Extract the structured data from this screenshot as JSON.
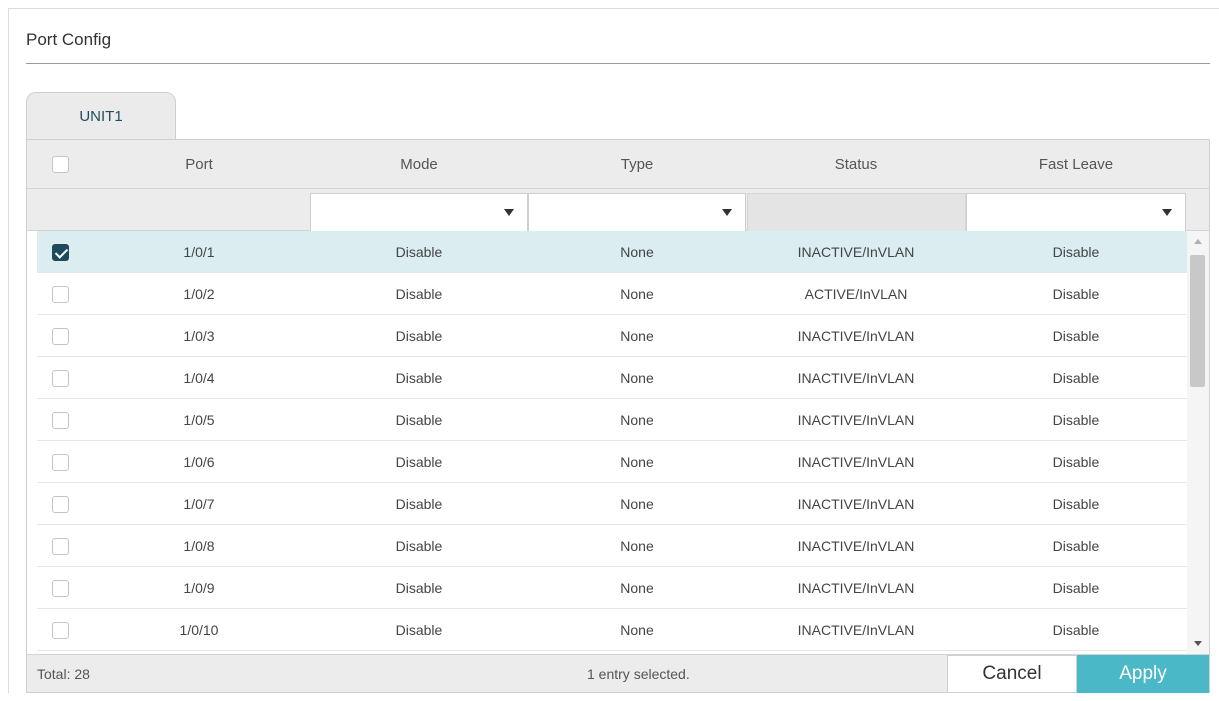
{
  "page": {
    "title": "Port Config"
  },
  "tabs": [
    {
      "label": "UNIT1"
    }
  ],
  "table": {
    "headers": {
      "port": "Port",
      "mode": "Mode",
      "type": "Type",
      "status": "Status",
      "fast_leave": "Fast Leave"
    },
    "filters": {
      "mode": "",
      "type": "",
      "fast_leave": ""
    },
    "rows": [
      {
        "selected": true,
        "port": "1/0/1",
        "mode": "Disable",
        "type": "None",
        "status": "INACTIVE/InVLAN",
        "fast_leave": "Disable"
      },
      {
        "selected": false,
        "port": "1/0/2",
        "mode": "Disable",
        "type": "None",
        "status": "ACTIVE/InVLAN",
        "fast_leave": "Disable"
      },
      {
        "selected": false,
        "port": "1/0/3",
        "mode": "Disable",
        "type": "None",
        "status": "INACTIVE/InVLAN",
        "fast_leave": "Disable"
      },
      {
        "selected": false,
        "port": "1/0/4",
        "mode": "Disable",
        "type": "None",
        "status": "INACTIVE/InVLAN",
        "fast_leave": "Disable"
      },
      {
        "selected": false,
        "port": "1/0/5",
        "mode": "Disable",
        "type": "None",
        "status": "INACTIVE/InVLAN",
        "fast_leave": "Disable"
      },
      {
        "selected": false,
        "port": "1/0/6",
        "mode": "Disable",
        "type": "None",
        "status": "INACTIVE/InVLAN",
        "fast_leave": "Disable"
      },
      {
        "selected": false,
        "port": "1/0/7",
        "mode": "Disable",
        "type": "None",
        "status": "INACTIVE/InVLAN",
        "fast_leave": "Disable"
      },
      {
        "selected": false,
        "port": "1/0/8",
        "mode": "Disable",
        "type": "None",
        "status": "INACTIVE/InVLAN",
        "fast_leave": "Disable"
      },
      {
        "selected": false,
        "port": "1/0/9",
        "mode": "Disable",
        "type": "None",
        "status": "INACTIVE/InVLAN",
        "fast_leave": "Disable"
      },
      {
        "selected": false,
        "port": "1/0/10",
        "mode": "Disable",
        "type": "None",
        "status": "INACTIVE/InVLAN",
        "fast_leave": "Disable"
      }
    ]
  },
  "footer": {
    "total": "Total: 28",
    "selection": "1 entry selected.",
    "cancel_label": "Cancel",
    "apply_label": "Apply"
  },
  "colors": {
    "accent": "#4bb8c7",
    "selected_row": "#dbedf1",
    "checkbox_checked": "#1f4a5e"
  },
  "icons": {
    "dropdown": "caret-down-icon",
    "checkbox": "checkbox-icon",
    "scroll_up": "scroll-up-arrow-icon",
    "scroll_down": "scroll-down-arrow-icon"
  }
}
